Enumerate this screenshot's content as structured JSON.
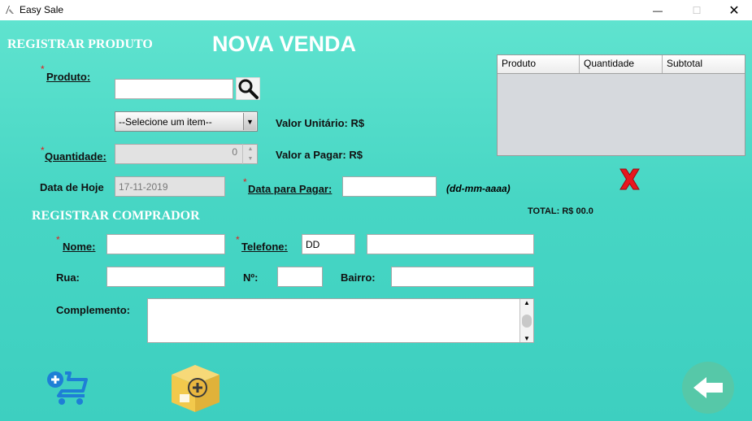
{
  "window": {
    "title": "Easy Sale",
    "minimize_glyph": "—",
    "maximize_glyph": "☐",
    "close_glyph": "✕"
  },
  "header": {
    "section_product": "REGISTRAR PRODUTO",
    "main_title": "NOVA VENDA"
  },
  "product": {
    "required_mark": "*",
    "label": "Produto:",
    "input_value": "",
    "select_value": "--Selecione um item--",
    "unit_value_label": "Valor Unitário: R$",
    "quantity_label": "Quantidade:",
    "quantity_value": "0",
    "pay_value_label": "Valor a Pagar: R$",
    "today_label": "Data de Hoje",
    "today_value": "17-11-2019",
    "pay_date_label": "Data para Pagar:",
    "pay_date_value": "",
    "date_format_hint": "(dd-mm-aaaa)"
  },
  "cart_table": {
    "columns": [
      "Produto",
      "Quantidade",
      "Subtotal"
    ],
    "rows": []
  },
  "total_label": "TOTAL: R$ 00.0",
  "buyer": {
    "section_title": "REGISTRAR COMPRADOR",
    "name_label": "Nome:",
    "name_value": "",
    "phone_label": "Telefone:",
    "phone_ddd_value": "DD",
    "phone_number_value": "",
    "street_label": "Rua:",
    "street_value": "",
    "number_label": "Nº:",
    "number_value": "",
    "district_label": "Bairro:",
    "district_value": "",
    "complement_label": "Complemento:",
    "complement_value": ""
  },
  "icons": {
    "search": "search-icon",
    "remove": "remove-item-icon",
    "add_to_cart": "add-to-cart-icon",
    "add_product": "add-product-box-icon",
    "back": "back-arrow-icon"
  },
  "colors": {
    "background_top": "#5fe3cf",
    "background_bottom": "#3dcfc0",
    "required": "#e02020",
    "remove_red": "#e8171f",
    "cart_blue": "#1e7fd6",
    "box_yellow": "#f2c94c"
  }
}
